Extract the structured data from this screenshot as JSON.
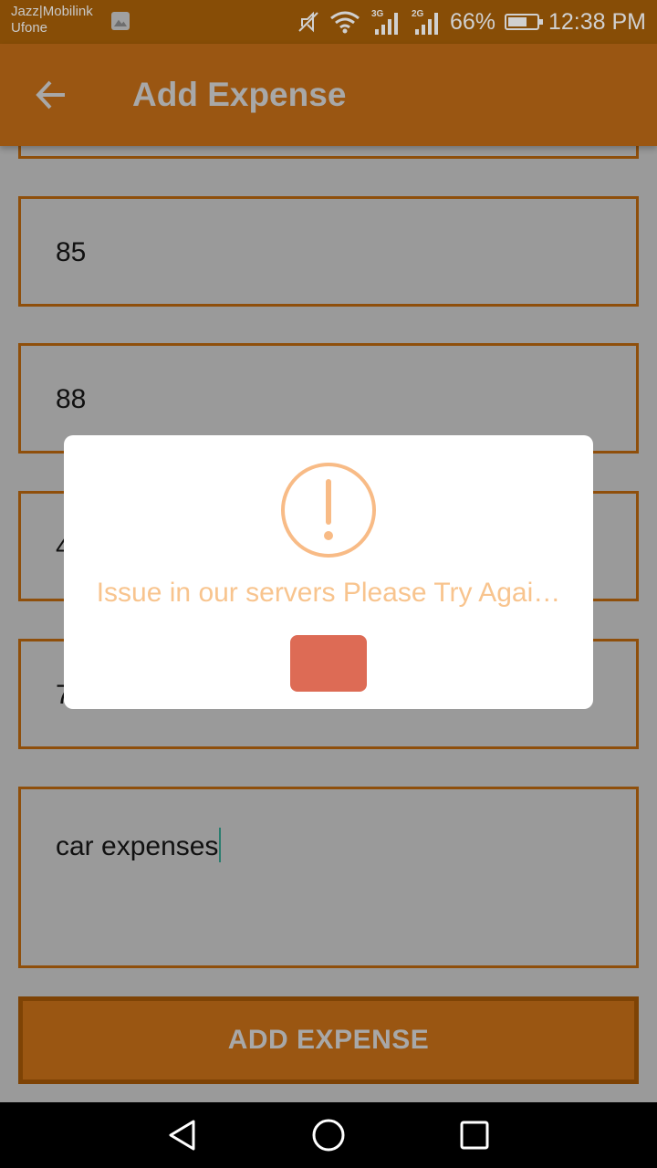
{
  "status_bar": {
    "carrier_line1": "Jazz|Mobilink",
    "carrier_line2": "Ufone",
    "network1": "3G",
    "network2": "2G",
    "battery": "66%",
    "time": "12:38 PM"
  },
  "app_bar": {
    "title": "Add Expense",
    "back_icon": "arrow-left-icon"
  },
  "form": {
    "field1_value": "85",
    "field2_value": "88",
    "field3_partial": "4",
    "field4_partial": "7",
    "description_value": "car expenses",
    "submit_label": "ADD EXPENSE"
  },
  "dialog": {
    "icon": "warning-circle-icon",
    "message": "Issue in our servers Please Try Agai…",
    "confirm_label": ""
  },
  "colors": {
    "primary": "#9a5612",
    "warning": "#f8bb86",
    "confirm": "#dd6b55"
  }
}
